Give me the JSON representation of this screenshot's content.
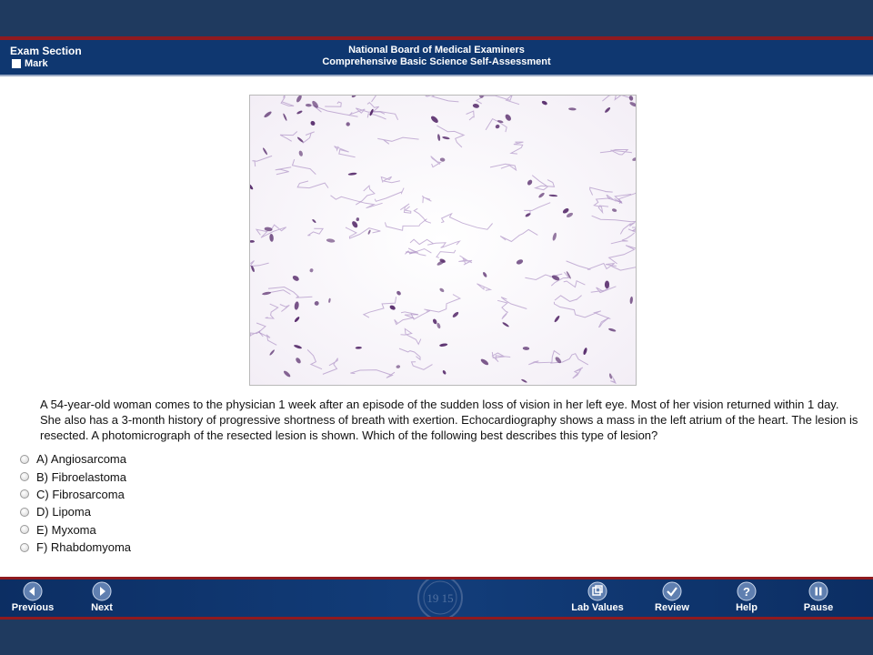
{
  "header": {
    "section_label": "Exam Section",
    "mark_label": "Mark",
    "title_line1": "National Board of Medical Examiners",
    "title_line2": "Comprehensive Basic Science Self-Assessment"
  },
  "question": {
    "stem": "A 54-year-old woman comes to the physician 1 week after an episode of the sudden loss of vision in her left eye. Most of her vision returned within 1 day. She also has a 3-month history of progressive shortness of breath with exertion. Echocardiography shows a mass in the left atrium of the heart. The lesion is resected. A photomicrograph of the resected lesion is shown. Which of the following best describes this type of lesion?",
    "options": [
      {
        "label": "A) Angiosarcoma"
      },
      {
        "label": "B) Fibroelastoma"
      },
      {
        "label": "C) Fibrosarcoma"
      },
      {
        "label": "D) Lipoma"
      },
      {
        "label": "E) Myxoma"
      },
      {
        "label": "F) Rhabdomyoma"
      }
    ]
  },
  "footer": {
    "previous_label": "Previous",
    "next_label": "Next",
    "lab_values_label": "Lab Values",
    "review_label": "Review",
    "help_label": "Help",
    "pause_label": "Pause",
    "seal_text": "19 15"
  },
  "colors": {
    "header_blue": "#0f3770",
    "accent_red": "#8f1a1f",
    "band_dark": "#1f3a5f",
    "stain_purple": "#8a5aa6"
  }
}
